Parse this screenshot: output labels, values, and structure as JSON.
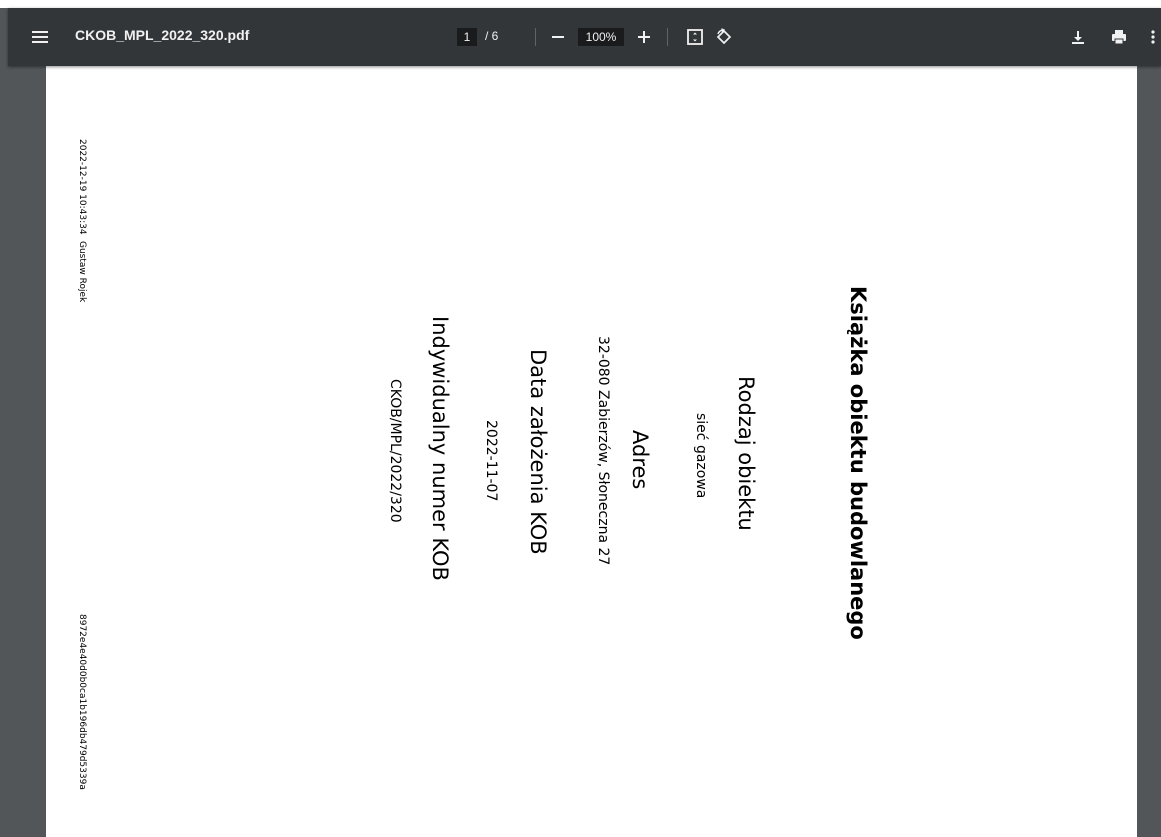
{
  "toolbar": {
    "file_name": "CKOB_MPL_2022_320.pdf",
    "current_page": "1",
    "page_separator": "/ 6",
    "zoom_value": "100%",
    "icons": {
      "menu": "menu-icon",
      "zoom_out": "minus-icon",
      "zoom_in": "plus-icon",
      "fit_page": "fit-to-page-icon",
      "rotate": "rotate-icon",
      "download": "download-icon",
      "print": "print-icon",
      "more": "more-vert-icon"
    }
  },
  "document": {
    "meta": {
      "timestamp": "2022-12-19 10:43:34",
      "author": "Gustaw Rojek",
      "hash": "8972e4e40d0b0ca1b196db479d5339a"
    },
    "title": "Książka obiektu budowlanego",
    "sections": [
      {
        "heading": "Rodzaj obiektu",
        "value": "sieć gazowa"
      },
      {
        "heading": "Adres",
        "value": "32-080 Zabierzów, Słoneczna 27"
      },
      {
        "heading": "Data założenia KOB",
        "value": "2022-11-07"
      },
      {
        "heading": "Indywidualny numer KOB",
        "value": "CKOB/MPL/2022/320"
      }
    ]
  },
  "colors": {
    "toolbar_bg": "#323639",
    "viewer_bg": "#525659",
    "page_bg": "#ffffff",
    "toolbar_text": "#f1f1f1"
  }
}
